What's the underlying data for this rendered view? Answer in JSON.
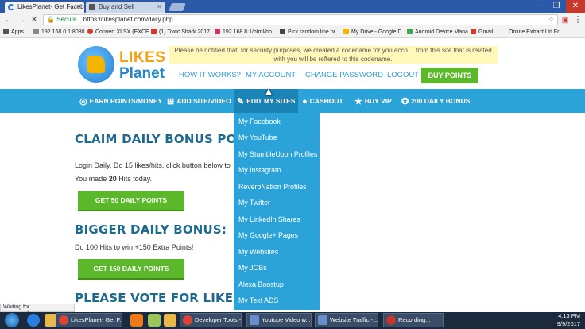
{
  "browser": {
    "tabs": [
      {
        "label": "LikesPlanet- Get Faceb",
        "active": true
      },
      {
        "label": "Buy and Sell",
        "active": false
      }
    ],
    "secure_label": "Secure",
    "url": "https://likesplanet.com/daily.php"
  },
  "bookmarks": [
    {
      "label": "Apps",
      "color": "#555555"
    },
    {
      "label": "192.168.0.1:8080",
      "color": "#888888"
    },
    {
      "label": "Convert XLSX (EXCE",
      "color": "#d33a2c"
    },
    {
      "label": "(1) Toxic Shark 2017",
      "color": "#d33a2c"
    },
    {
      "label": "192.168.8.1/html/ho",
      "color": "#cc3366"
    },
    {
      "label": "Pick random line or",
      "color": "#444444"
    },
    {
      "label": "My Drive - Google D",
      "color": "#f4b400"
    },
    {
      "label": "Android Device Mana",
      "color": "#3aa757"
    },
    {
      "label": "Gmail",
      "color": "#d33a2c"
    },
    {
      "label": "Online Extract Url Fr",
      "color": "#555555"
    }
  ],
  "logo": {
    "word1": "LIKES",
    "word2": "Planet"
  },
  "notice": "Please be notified that, for security purposes, we created a codename for you acco… from this site that is related with you will be reffered to this codename.",
  "topnav": {
    "how": "HOW IT WORKS?",
    "account": "MY ACCOUNT",
    "password": "CHANGE PASSWORD",
    "logout": "LOGOUT",
    "buy": "BUY POINTS"
  },
  "bluebar": {
    "earn": "EARN POINTS/MONEY",
    "add": "ADD SITE/VIDEO",
    "edit": "EDIT MY SITES",
    "cashout": "CASHOUT",
    "vip": "BUY VIP",
    "bonus": "200 DAILY BONUS"
  },
  "dropdown": [
    "My Facebook",
    "My YouTube",
    "My StumbleUpon Profiles",
    "My Instagram",
    "ReverbNation Profiles",
    "My Twitter",
    "My LinkedIn Shares",
    "My Google+ Pages",
    "My Websites",
    "My JOBs",
    "Alexa Boostup",
    "My Text ADS"
  ],
  "content": {
    "h1": "CLAIM DAILY BONUS POINTS",
    "p1": "Login Daily, Do 15 likes/hits, click button below to",
    "p2_prefix": "You made ",
    "p2_count": "20",
    "p2_suffix": " Hits today.",
    "btn1": "GET 50 DAILY POINTS",
    "h2": "BIGGER DAILY BONUS:",
    "p3": "Do 100 Hits to win +150 Extra Points!",
    "btn2": "GET 150 DAILY POINTS",
    "h3": "PLEASE VOTE FOR LIKESPLANET DA"
  },
  "status": "Waiting for apis.google.com...",
  "taskbar": {
    "apps": [
      {
        "label": "LikesPlanet- Get F...",
        "color": "#db4437"
      },
      {
        "label": "Developer Tools -...",
        "color": "#db4437"
      },
      {
        "label": "Youtube Video w...",
        "color": "#6a8fc8"
      },
      {
        "label": "Website Traffic -...",
        "color": "#6a8fc8"
      },
      {
        "label": "Recording...",
        "color": "#c0392b"
      }
    ],
    "time": "4:13 PM",
    "date": "9/9/2017"
  }
}
